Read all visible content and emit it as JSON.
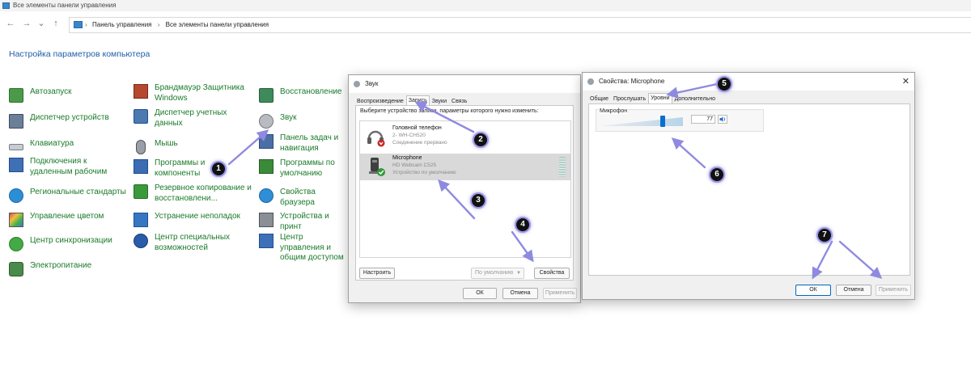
{
  "window": {
    "title": "Все элементы панели управления"
  },
  "address": {
    "crumb1": "Панель управления",
    "crumb2": "Все элементы панели управления"
  },
  "nav": {
    "back": "←",
    "forward": "→",
    "recent": "⌄",
    "up": "↑"
  },
  "heading": "Настройка параметров компьютера",
  "cp_items": {
    "col1": [
      {
        "label": "Автозапуск",
        "icon": "autoplay-icon"
      },
      {
        "label": "Диспетчер устройств",
        "icon": "device-manager-icon"
      },
      {
        "label": "Клавиатура",
        "icon": "keyboard-icon"
      },
      {
        "label": "Подключения к удаленным рабочим",
        "icon": "remote-connections-icon"
      },
      {
        "label": "Региональные стандарты",
        "icon": "region-icon"
      },
      {
        "label": "Управление цветом",
        "icon": "color-management-icon"
      },
      {
        "label": "Центр синхронизации",
        "icon": "sync-center-icon"
      },
      {
        "label": "Электропитание",
        "icon": "power-options-icon"
      }
    ],
    "col2": [
      {
        "label": "Брандмауэр Защитника Windows",
        "icon": "firewall-icon"
      },
      {
        "label": "Диспетчер учетных данных",
        "icon": "credential-manager-icon"
      },
      {
        "label": "Мышь",
        "icon": "mouse-icon"
      },
      {
        "label": "Программы и компоненты",
        "icon": "programs-features-icon"
      },
      {
        "label": "Резервное копирование и восстановлени...",
        "icon": "backup-restore-icon"
      },
      {
        "label": "Устранение неполадок",
        "icon": "troubleshooting-icon"
      },
      {
        "label": "Центр специальных возможностей",
        "icon": "ease-of-access-icon"
      }
    ],
    "col3": [
      {
        "label": "Восстановление",
        "icon": "recovery-icon"
      },
      {
        "label": "Звук",
        "icon": "sound-icon"
      },
      {
        "label": "Панель задач и навигация",
        "icon": "taskbar-icon"
      },
      {
        "label": "Программы по умолчанию",
        "icon": "default-programs-icon"
      },
      {
        "label": "Свойства браузера",
        "icon": "internet-options-icon"
      },
      {
        "label": "Устройства и принт",
        "icon": "devices-printers-icon"
      },
      {
        "label": "Центр управления и общим доступом",
        "icon": "network-center-icon"
      }
    ]
  },
  "sound_dialog": {
    "title": "Звук",
    "tabs": [
      "Воспроизведение",
      "Запись",
      "Звуки",
      "Связь"
    ],
    "active_tab": "Запись",
    "instruction": "Выберите устройство записи, параметры которого нужно изменить:",
    "devices": [
      {
        "name": "Головной телефон",
        "model": "2- WH-CH520",
        "status": "Соединение прервано",
        "selected": false
      },
      {
        "name": "Microphone",
        "model": "HD Webcam C525",
        "status": "Устройство по умолчанию",
        "selected": true
      }
    ],
    "configure_button": "Настроить",
    "default_select": "По умолчанию",
    "properties_button": "Свойства",
    "ok_button": "ОК",
    "cancel_button": "Отмена",
    "apply_button": "Применить"
  },
  "mic_dialog": {
    "title": "Свойства: Microphone",
    "tabs": [
      "Общие",
      "Прослушать",
      "Уровни",
      "Дополнительно"
    ],
    "active_tab": "Уровни",
    "level_label": "Микрофон",
    "level_value": "77",
    "level_fraction": 0.77,
    "ok_button": "ОК",
    "cancel_button": "Отмена",
    "apply_button": "Применить"
  },
  "annotations": [
    "1",
    "2",
    "3",
    "4",
    "5",
    "6",
    "7"
  ],
  "colors": {
    "link_green": "#1a7a2a",
    "heading_blue": "#1e5faa",
    "arrow": "#8f8ae0",
    "badge": "#111111"
  }
}
